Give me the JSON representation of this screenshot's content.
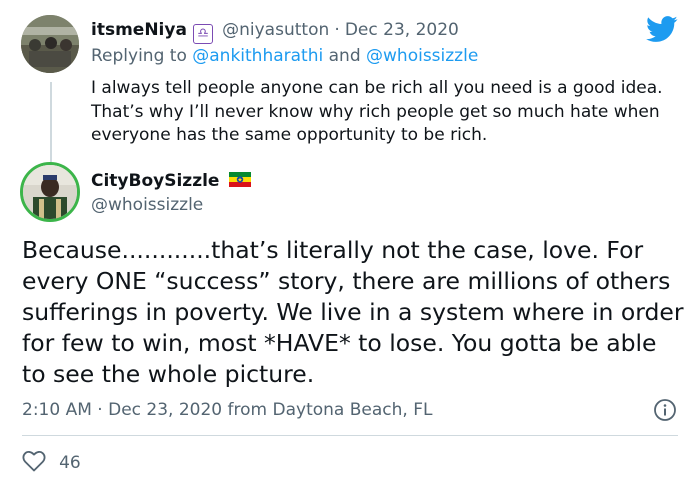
{
  "original_tweet": {
    "author_name": "itsmeNiya",
    "author_badge": "♎",
    "handle": "@niyasutton",
    "separator": "·",
    "date": "Dec 23, 2020",
    "reply_prefix": "Replying to",
    "reply_user1": "@ankithharathi",
    "reply_and": "and",
    "reply_user2": "@whoissizzle",
    "text": "I always tell people anyone can be rich all you need is a good idea. That’s why I’ll never know why rich people get so much hate when everyone has the same opportunity to be rich."
  },
  "reply_tweet": {
    "author_name": "CityBoySizzle",
    "handle": "@whoissizzle",
    "text": "Because............that’s literally not the case, love. For every ONE “success” story, there are millions of others sufferings in poverty. We live in a system where in order for few to win, most *HAVE* to lose. You gotta be able to see the whole picture.",
    "time": "2:10 AM",
    "separator": "·",
    "date": "Dec 23, 2020",
    "source": "from Daytona Beach, FL",
    "likes": "46"
  },
  "colors": {
    "accent": "#1d9bf0",
    "muted": "#536471",
    "green_ring": "#3cb54a"
  }
}
